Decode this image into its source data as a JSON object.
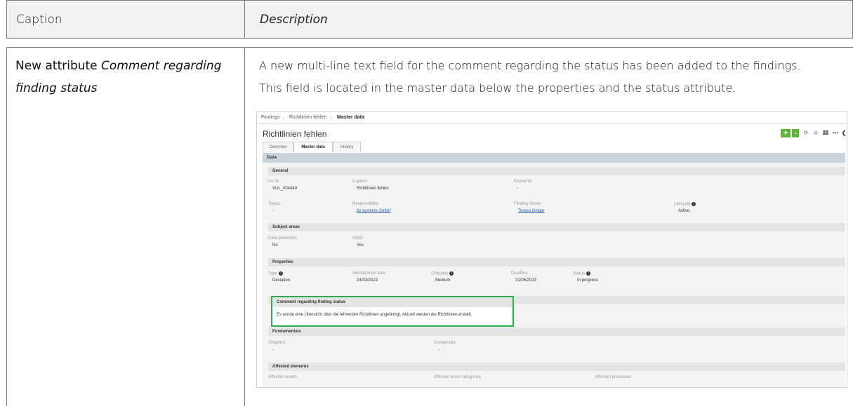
{
  "header": {
    "caption": "Caption",
    "description": "Description"
  },
  "row": {
    "caption_plain": "New attribute ",
    "caption_italic_1": "Comment regarding",
    "caption_italic_2": "finding status",
    "desc_line1": "A new multi-line text field for the comment regarding the status has been added to the findings.",
    "desc_line2": "This field is located in the master data below the properties and the status attribute."
  },
  "app": {
    "breadcrumb": [
      "Findings",
      "Richtlinien fehlen",
      "Master data"
    ],
    "title": "Richtlinien fehlen",
    "toolbar": {
      "add": "+",
      "caret": "⌄",
      "refresh": "⟳",
      "chart": "ılı",
      "people": "👥",
      "more": "•••",
      "back": "❮"
    },
    "tabs": [
      "Overview",
      "Master data",
      "History"
    ],
    "data_label": "Data",
    "general": {
      "heading": "General",
      "iris_id_label": "iris ID",
      "iris_id": "VUL_004440",
      "caption_label": "Caption",
      "caption": "Richtlinien fehlen",
      "keywords_label": "Keywords",
      "keywords": "-",
      "topics_label": "Topics",
      "topics": "-",
      "responsibility_label": "Responsibility",
      "responsibility": "ibi systems GmbH",
      "owner_label": "Finding Owner",
      "owner": "Teresa Geiger",
      "lifecycle_label": "Lifecycle",
      "lifecycle": "Active"
    },
    "subject": {
      "heading": "Subject areas",
      "dp_label": "Data protection",
      "dp": "No",
      "isms_label": "ISMS",
      "isms": "Yes"
    },
    "properties": {
      "heading": "Properties",
      "type_label": "Type",
      "type": "Deviation",
      "idate_label": "Identification date",
      "idate": "24/03/2023",
      "crit_label": "Criticality",
      "crit": "Medium",
      "deadline_label": "Deadline",
      "deadline": "31/05/2023",
      "status_label": "Status",
      "status": "In progress"
    },
    "comment": {
      "heading": "Comment regarding finding status",
      "text": "Es wurde eine Übersicht über die fehlenden Richtlinien angefertigt. Aktuell werden die Richtlinien erstellt."
    },
    "fundamentals": {
      "heading": "Fundamentals",
      "chapters_label": "Chapters",
      "chapters": "-",
      "compendia_label": "Compendia",
      "compendia": "-"
    },
    "affected": {
      "heading": "Affected elements",
      "assets_label": "Affected assets",
      "categories_label": "Affected asset categories",
      "processes_label": "Affected processes"
    },
    "highlight_color": "#22b14c"
  }
}
